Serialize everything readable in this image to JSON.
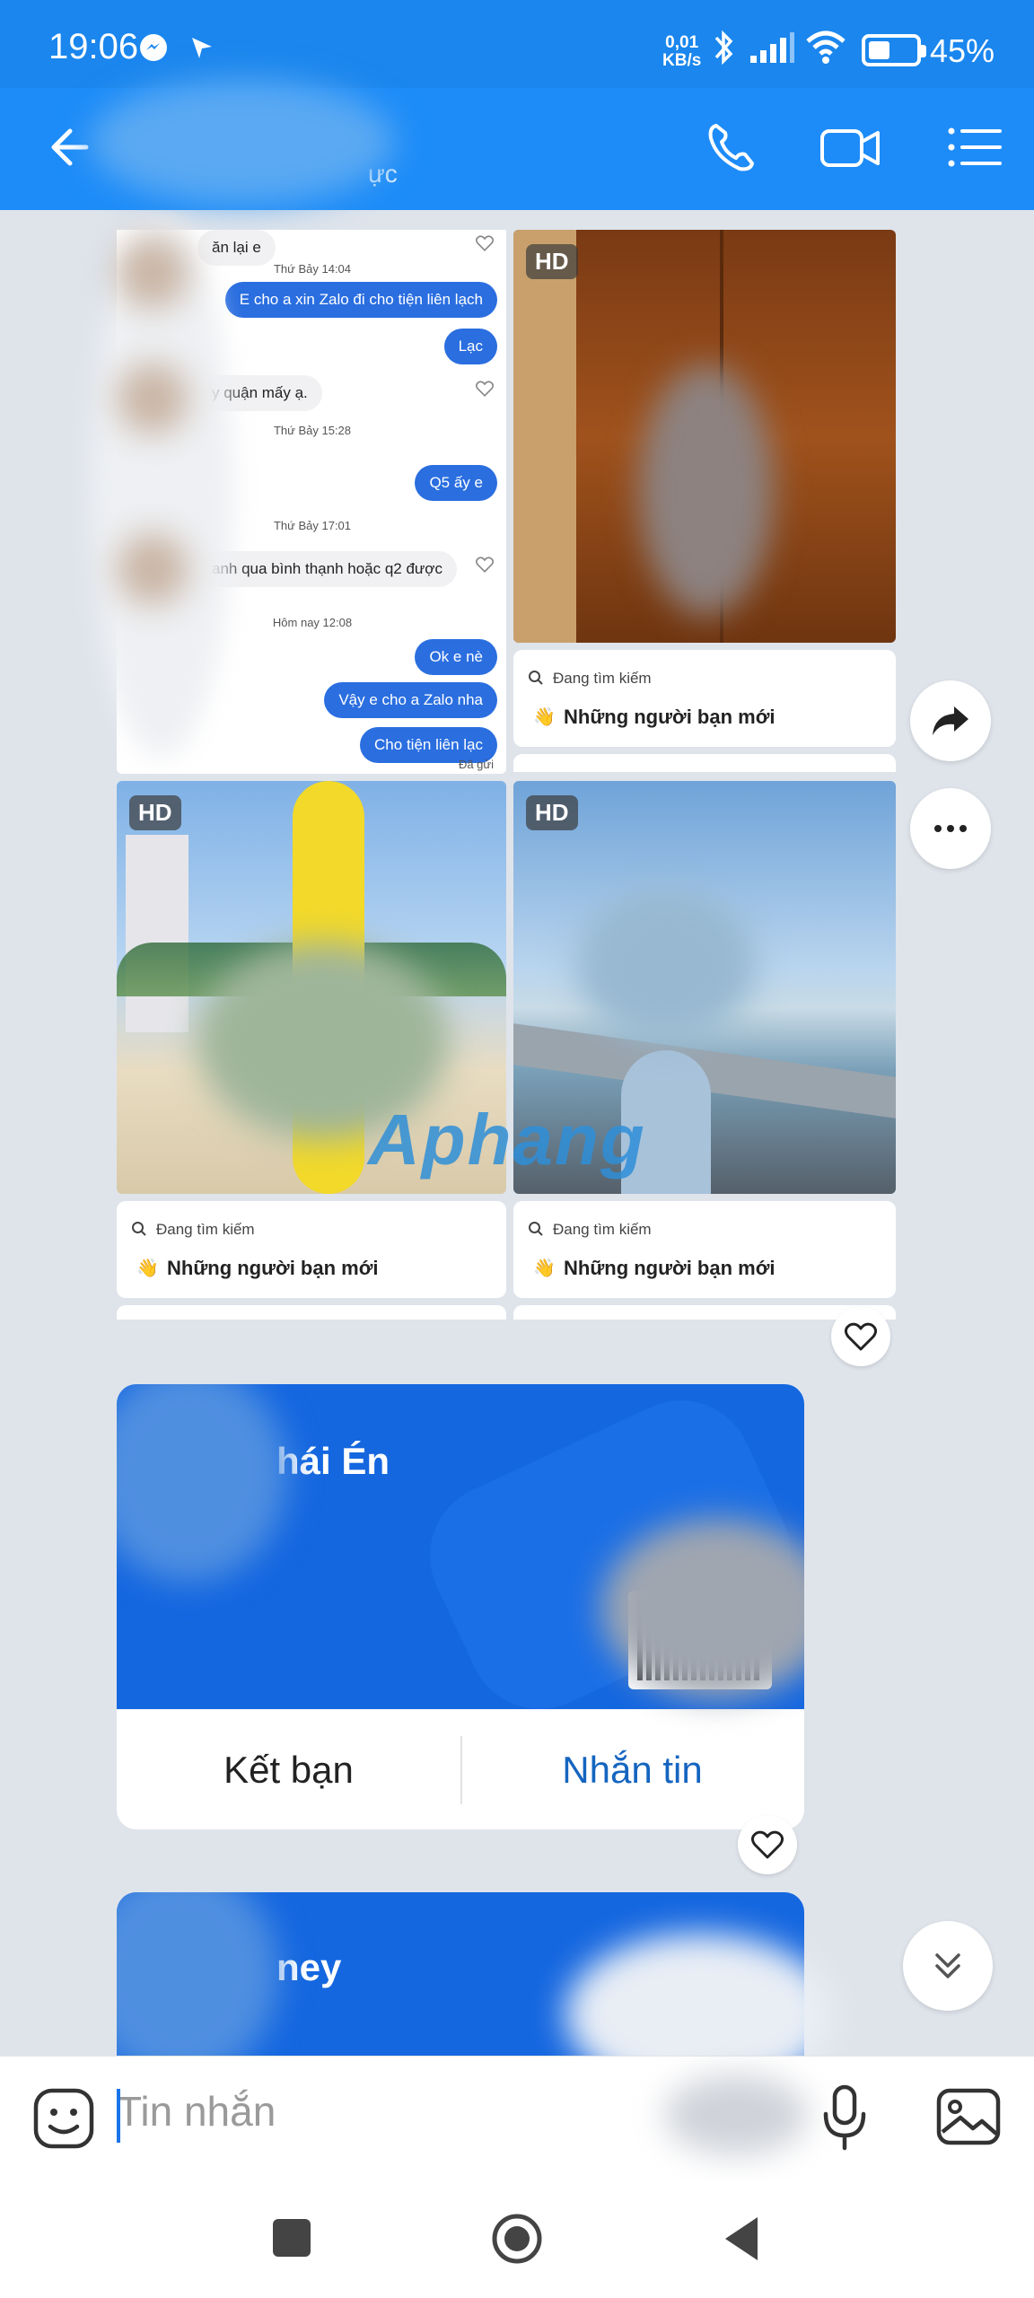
{
  "status_bar": {
    "time": "19:06",
    "net_speed_value": "0,01",
    "net_speed_unit": "KB/s",
    "battery_pct": "45%",
    "battery_level": 0.45
  },
  "header": {
    "title": "",
    "subtitle": "ực"
  },
  "screenshot_chat": {
    "msgs": [
      {
        "kind": "in",
        "text": "ăn lại e"
      },
      {
        "kind": "ts",
        "text": "Thứ Bảy 14:04"
      },
      {
        "kind": "out",
        "text": "E cho a xin Zalo đi cho tiện liên lạch"
      },
      {
        "kind": "out",
        "text": "Lạc"
      },
      {
        "kind": "in",
        "text": "y quận mấy ạ."
      },
      {
        "kind": "ts",
        "text": "Thứ Bảy 15:28"
      },
      {
        "kind": "out",
        "text": "Q5 ấy e"
      },
      {
        "kind": "ts",
        "text": "Thứ Bảy 17:01"
      },
      {
        "kind": "in",
        "text": "anh qua bình thạnh hoặc q2 được"
      },
      {
        "kind": "ts",
        "text": "Hôm nay 12:08"
      },
      {
        "kind": "out",
        "text": "Ok e nè"
      },
      {
        "kind": "out",
        "text": "Vậy e cho a Zalo nha"
      },
      {
        "kind": "out",
        "text": "Cho tiện liên lạc"
      }
    ],
    "sent_status": "Đã gửi"
  },
  "photos": {
    "hd_badge": "HD"
  },
  "search_cards": [
    {
      "label": "Đang tìm kiếm",
      "title": "Những người bạn mới"
    },
    {
      "label": "Đang tìm kiếm",
      "title": "Những người bạn mới"
    },
    {
      "label": "Đang tìm kiếm",
      "title": "Những người bạn mới"
    }
  ],
  "watermark": "Aphang",
  "contact_cards": [
    {
      "name": "hái Én",
      "add_friend": "Kết bạn",
      "message": "Nhắn tin"
    },
    {
      "name": "ney"
    }
  ],
  "composer": {
    "placeholder": "Tin nhắn"
  },
  "colors": {
    "brand_blue": "#1d8cf8",
    "card_blue": "#1567e0",
    "bubble_out": "#2a6ee0",
    "action_blue": "#1565c0"
  },
  "icons": [
    "back-arrow-icon",
    "phone-icon",
    "video-call-icon",
    "menu-list-icon",
    "share-forward-icon",
    "more-options-icon",
    "heart-icon",
    "scroll-down-icon",
    "emoji-sticker-icon",
    "microphone-icon",
    "image-gallery-icon"
  ]
}
